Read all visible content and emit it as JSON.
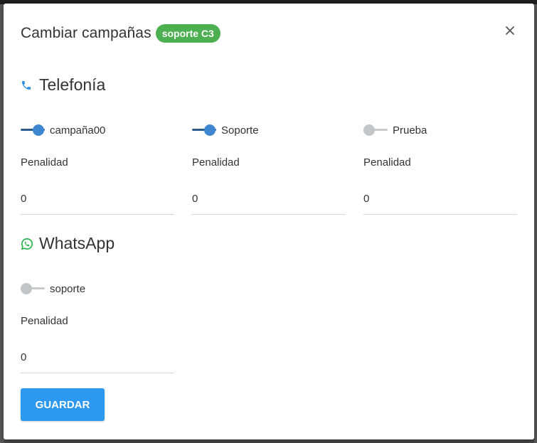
{
  "modal": {
    "title": "Cambiar campañas",
    "badge": "soporte C3",
    "close_label": "×"
  },
  "sections": {
    "telefonia": {
      "title": "Telefonía",
      "campaigns": [
        {
          "name": "campaña00",
          "enabled": true,
          "penalty_label": "Penalidad",
          "penalty_value": "0"
        },
        {
          "name": "Soporte",
          "enabled": true,
          "penalty_label": "Penalidad",
          "penalty_value": "0"
        },
        {
          "name": "Prueba",
          "enabled": false,
          "penalty_label": "Penalidad",
          "penalty_value": "0"
        }
      ]
    },
    "whatsapp": {
      "title": "WhatsApp",
      "campaigns": [
        {
          "name": "soporte",
          "enabled": false,
          "penalty_label": "Penalidad",
          "penalty_value": "0"
        }
      ]
    }
  },
  "footer": {
    "save_label": "GUARDAR"
  },
  "colors": {
    "badge": "#4caf50",
    "toggle_on": "#3f86d0",
    "toggle_off": "#c3c5c8",
    "save_button": "#2d98f0",
    "phone_icon": "#2d8ee0",
    "whatsapp_icon": "#25b34a"
  },
  "icons": {
    "telefonia": "phone-icon",
    "whatsapp": "whatsapp-icon",
    "close": "close-icon"
  }
}
